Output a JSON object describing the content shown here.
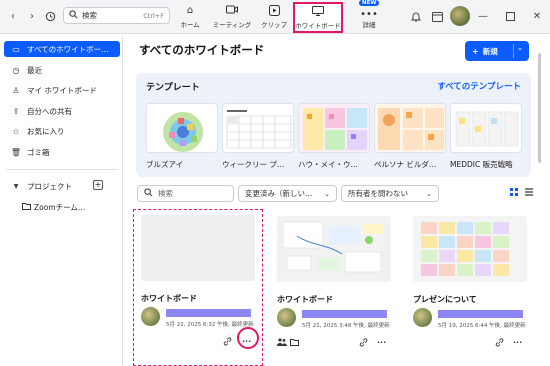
{
  "topbar": {
    "back_icon": "chevron-left-icon",
    "forward_icon": "chevron-right-icon",
    "history_icon": "history-icon",
    "search_label": "検索",
    "search_shortcut": "Ctrl+F",
    "nav": [
      {
        "label": "ホーム",
        "icon": "home-icon"
      },
      {
        "label": "ミーティング",
        "icon": "video-icon"
      },
      {
        "label": "クリップ",
        "icon": "clips-icon"
      },
      {
        "label": "ホワイトボード",
        "icon": "whiteboard-icon"
      },
      {
        "label": "詳細",
        "icon": "more-icon"
      }
    ],
    "new_badge": "NEW"
  },
  "sidebar": {
    "items": [
      {
        "label": "すべてのホワイトボー…",
        "icon": "whiteboard-icon"
      },
      {
        "label": "最近",
        "icon": "clock-icon"
      },
      {
        "label": "マイ ホワイトボード",
        "icon": "person-icon"
      },
      {
        "label": "自分への共有",
        "icon": "shared-icon"
      },
      {
        "label": "お気に入り",
        "icon": "star-icon"
      },
      {
        "label": "ゴミ箱",
        "icon": "trash-icon"
      }
    ],
    "projects_label": "プロジェクト",
    "project_item": "Zoomチーム…"
  },
  "main": {
    "title": "すべてのホワイトボード",
    "new_button": "新規",
    "templates": {
      "heading": "テンプレート",
      "see_all": "すべてのテンプレート",
      "items": [
        {
          "label": "ブルズアイ"
        },
        {
          "label": "ウィークリー プ…"
        },
        {
          "label": "ハウ・メイ・ウ…"
        },
        {
          "label": "ペルソナ ビルダ…"
        },
        {
          "label": "MEDDIC 販売戦略"
        }
      ]
    },
    "filters": {
      "search_placeholder": "検索",
      "sort": "変更済み（新しい…",
      "owner": "所有者を問わない"
    },
    "cards": [
      {
        "title": "ホワイトボード",
        "meta": "5月 22, 2025 6:32 午後, 最終更新"
      },
      {
        "title": "ホワイトボード",
        "meta": "5月 21, 2025 3:48 午後, 最終更新"
      },
      {
        "title": "プレゼンについて",
        "meta": "5月 19, 2025 6:44 午後, 最終更新"
      }
    ]
  }
}
